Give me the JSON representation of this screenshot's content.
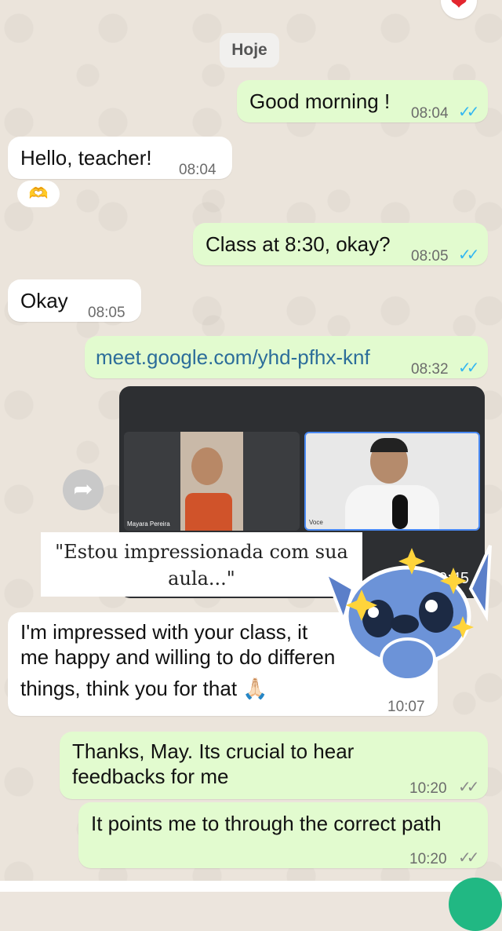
{
  "chat": {
    "date_chip": "Hoje",
    "reaction": "❤",
    "messages": [
      {
        "text": "Good morning !",
        "time": "08:04",
        "ticks": "✓✓"
      },
      {
        "text": "Hello, teacher!",
        "time": "08:04",
        "reaction": "🫶"
      },
      {
        "text": "Class at 8:30, okay?",
        "time": "08:05",
        "ticks": "✓✓"
      },
      {
        "text": "Okay",
        "time": "08:05"
      },
      {
        "text": "meet.google.com/yhd-pfhx-knf",
        "time": "08:32",
        "ticks": "✓✓"
      },
      {
        "line1": "I'm impressed with your class, it",
        "line2": "me happy and willing to do differen",
        "line3": "things, think you for that 🙏🏻",
        "time": "10:07"
      },
      {
        "line1": "Thanks, May. Its crucial to hear",
        "line2": "feedbacks for me",
        "time": "10:20",
        "ticks": "✓✓"
      },
      {
        "text": "It points me to through the correct path",
        "time": "10:20",
        "ticks": "✓✓"
      }
    ],
    "video": {
      "time_overlay": "09:45",
      "participant_left": "Mayara Pereira",
      "participant_right": "Voce"
    },
    "caption": {
      "line1": "\"Estou impressionada com sua",
      "line2": "aula...\""
    }
  },
  "colors": {
    "outgoing": "#e2fbcf",
    "incoming": "#ffffff",
    "read_ticks": "#34b7f1",
    "link": "#2c6d9a"
  }
}
